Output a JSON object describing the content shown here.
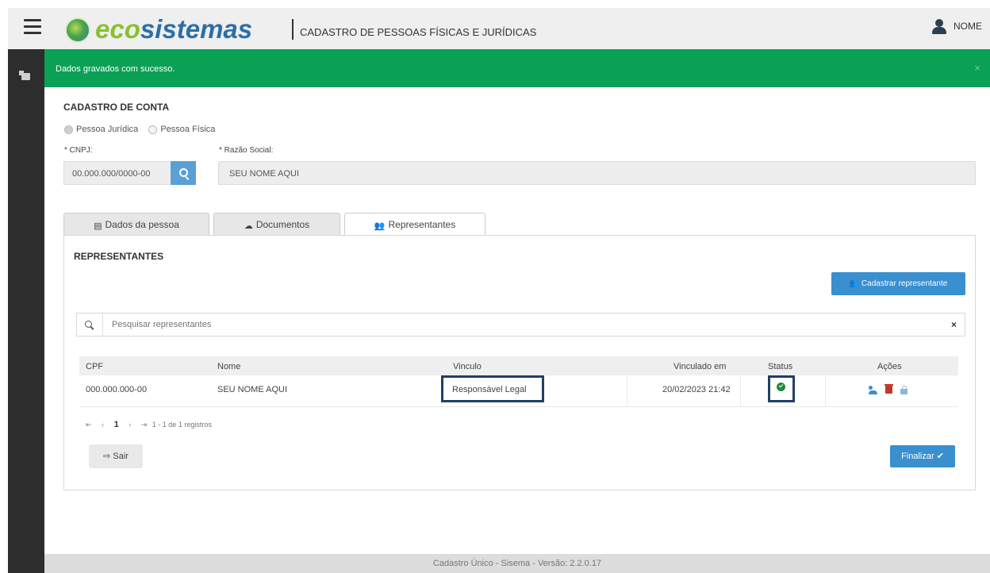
{
  "header": {
    "brand_eco": "eco",
    "brand_sistemas": "sistemas",
    "subtitle": "CADASTRO DE PESSOAS FÍSICAS E JURÍDICAS",
    "user_name": "NOME"
  },
  "alert": {
    "message": "Dados gravados com sucesso.",
    "close": "×"
  },
  "form": {
    "section_title": "CADASTRO DE CONTA",
    "radio_juridica": "Pessoa Jurídica",
    "radio_fisica": "Pessoa Física",
    "cnpj_label": "* CNPJ:",
    "cnpj_value": "00.000.000/0000-00",
    "razao_label": "* Razão Social:",
    "razao_value": "SEU NOME AQUI"
  },
  "tabs": [
    {
      "label": "Dados da pessoa"
    },
    {
      "label": "Documentos"
    },
    {
      "label": "Representantes"
    }
  ],
  "representantes": {
    "title": "REPRESENTANTES",
    "add_button": "Cadastrar representante",
    "search_placeholder": "Pesquisar representantes",
    "clear": "×",
    "columns": {
      "cpf": "CPF",
      "nome": "Nome",
      "vinculo": "Vinculo",
      "vinculado_em": "Vinculado em",
      "status": "Status",
      "acoes": "Ações"
    },
    "rows": [
      {
        "cpf": "000.000.000-00",
        "nome": "SEU NOME AQUI",
        "vinculo": "Responsável Legal",
        "vinculado_em": "20/02/2023 21:42",
        "status": "ativo"
      }
    ],
    "pager": {
      "first": "⇤",
      "prev": "‹",
      "page": "1",
      "next": "›",
      "last": "⇥",
      "summary": "1 - 1 de 1 registros"
    }
  },
  "buttons": {
    "sair": "Sair",
    "finalizar": "Finalizar ✔"
  },
  "footer": {
    "text": "Cadastro Único - Sisema - Versão: 2.2.0.17"
  },
  "colors": {
    "success": "#0aa056",
    "primary": "#3a8fcf",
    "highlight": "#223f63",
    "sidebar": "#2d2d2d"
  }
}
